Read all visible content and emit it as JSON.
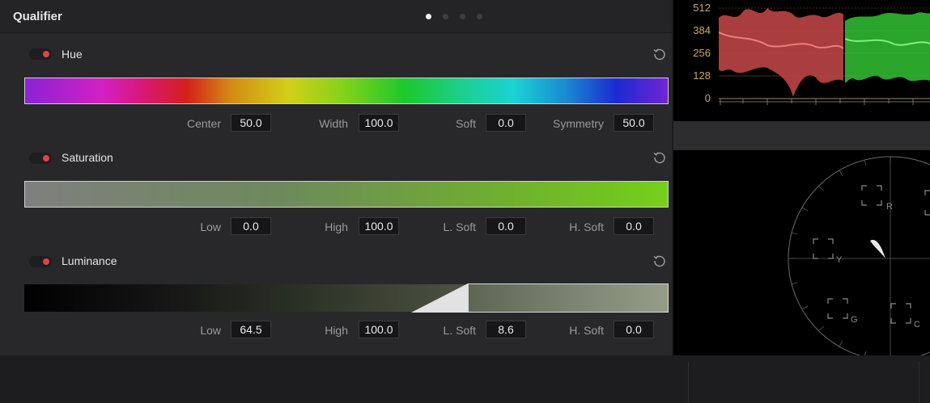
{
  "header": {
    "title": "Qualifier",
    "page_dots": 4,
    "active_dot": 0
  },
  "hue": {
    "label": "Hue",
    "enabled": true,
    "fields": [
      {
        "label": "Center",
        "value": "50.0"
      },
      {
        "label": "Width",
        "value": "100.0"
      },
      {
        "label": "Soft",
        "value": "0.0"
      },
      {
        "label": "Symmetry",
        "value": "50.0"
      }
    ]
  },
  "saturation": {
    "label": "Saturation",
    "enabled": true,
    "fields": [
      {
        "label": "Low",
        "value": "0.0"
      },
      {
        "label": "High",
        "value": "100.0"
      },
      {
        "label": "L. Soft",
        "value": "0.0"
      },
      {
        "label": "H. Soft",
        "value": "0.0"
      }
    ]
  },
  "luminance": {
    "label": "Luminance",
    "enabled": true,
    "fields": [
      {
        "label": "Low",
        "value": "64.5"
      },
      {
        "label": "High",
        "value": "100.0"
      },
      {
        "label": "L. Soft",
        "value": "8.6"
      },
      {
        "label": "H. Soft",
        "value": "0.0"
      }
    ]
  },
  "waveform": {
    "y_labels": [
      "512",
      "384",
      "256",
      "128",
      "0"
    ]
  },
  "vectorscope": {
    "targets": [
      "R",
      "Y",
      "G",
      "C"
    ]
  },
  "colors": {
    "toggle_on": "#e0453b",
    "waveform_label": "#c9a866",
    "accent_red": "#e85a5a",
    "accent_green": "#3ed33e"
  }
}
